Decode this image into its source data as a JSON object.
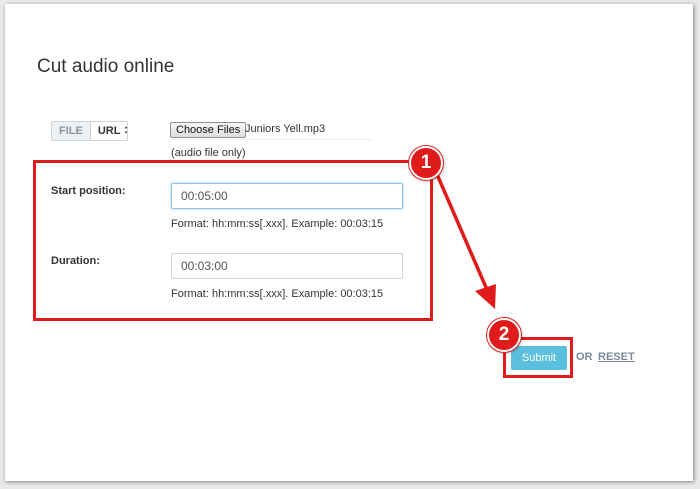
{
  "page": {
    "title": "Cut audio online"
  },
  "source_toggle": {
    "file_label": "FILE",
    "url_label": "URL",
    "colon": ":"
  },
  "file_input": {
    "button_label": "Choose Files",
    "file_name": "Juniors Yell.mp3",
    "hint": "(audio file only)"
  },
  "start": {
    "label": "Start position:",
    "value": "00:05:00",
    "format_hint": "Format: hh:mm:ss[.xxx]. Example: 00:03:15"
  },
  "duration": {
    "label": "Duration:",
    "value": "00:03:00",
    "format_hint": "Format: hh:mm:ss[.xxx]. Example: 00:03:15"
  },
  "actions": {
    "submit_label": "Submit",
    "or_label": "OR",
    "reset_label": "RESET"
  },
  "annotations": {
    "step_1": "1",
    "step_2": "2"
  },
  "colors": {
    "accent": "#5bc0de",
    "annotation_red": "#e01b1b",
    "link": "#7a8a9a"
  }
}
